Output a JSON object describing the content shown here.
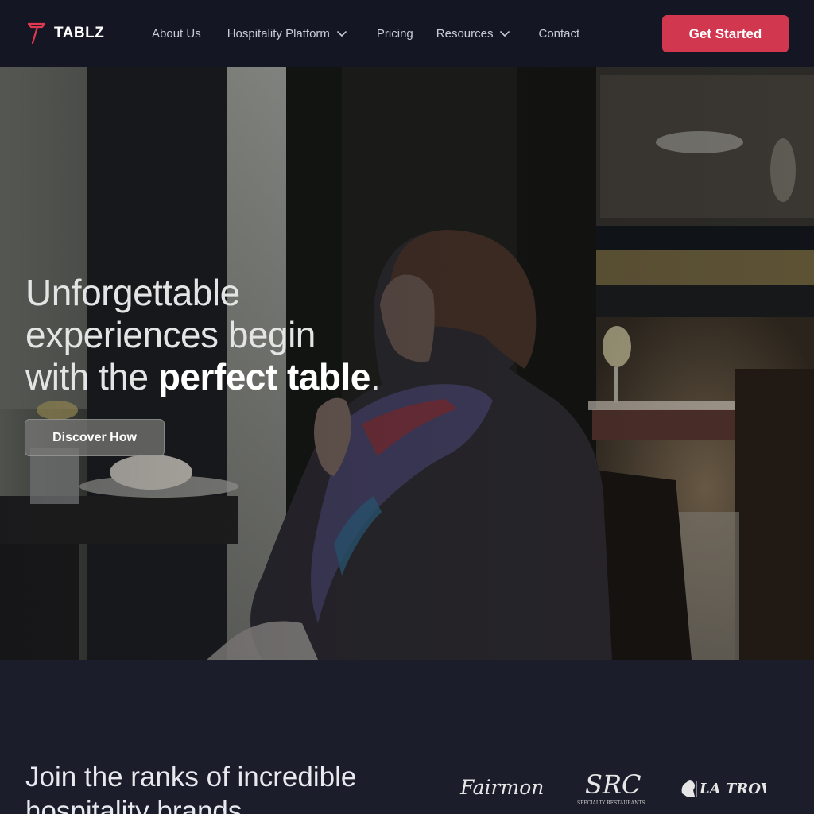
{
  "nav": {
    "brand": "TABLZ",
    "links": [
      {
        "label": "About Us",
        "has_dropdown": false
      },
      {
        "label": "Hospitality Platform",
        "has_dropdown": true
      },
      {
        "label": "Pricing",
        "has_dropdown": false
      },
      {
        "label": "Resources",
        "has_dropdown": true
      },
      {
        "label": "Contact",
        "has_dropdown": false
      }
    ],
    "cta_label": "Get Started"
  },
  "hero": {
    "title_line1": "Unforgettable",
    "title_line2": "experiences begin",
    "title_line3_plain": "with the ",
    "title_line3_strong": "perfect table",
    "title_line3_end": ".",
    "button_label": "Discover How"
  },
  "brands": {
    "title": "Join the ranks of incredible hospitality brands",
    "logos": [
      {
        "name": "Fairmont",
        "icon": "fairmont-logo"
      },
      {
        "name": "SRC",
        "subtitle": "SPECIALTY RESTAURANTS",
        "icon": "src-logo"
      },
      {
        "name": "LA TROVA",
        "icon": "la-trova-logo"
      }
    ]
  },
  "colors": {
    "nav_bg": "#141624",
    "page_bg": "#1b1d2a",
    "accent": "#d1384f",
    "nav_text": "#c9ccd6"
  }
}
